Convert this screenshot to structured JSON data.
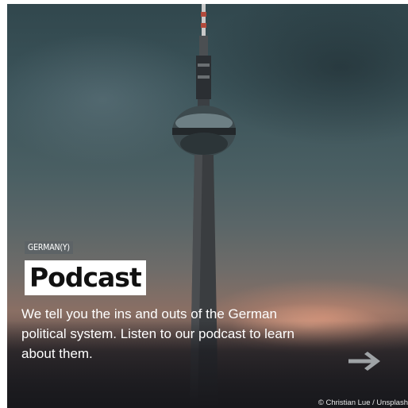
{
  "card": {
    "tag": "GERMAN(Y)",
    "title": "Podcast",
    "description": "We tell you the ins and outs of the German political system. Listen to our podcast to learn about them.",
    "arrow_icon": "arrow-right-icon",
    "credit": "© Christian Lue / Unsplash"
  },
  "colors": {
    "tag_bg": "#5d6366",
    "title_bg": "#ffffff",
    "title_text": "#111111",
    "text": "#ffffff"
  }
}
